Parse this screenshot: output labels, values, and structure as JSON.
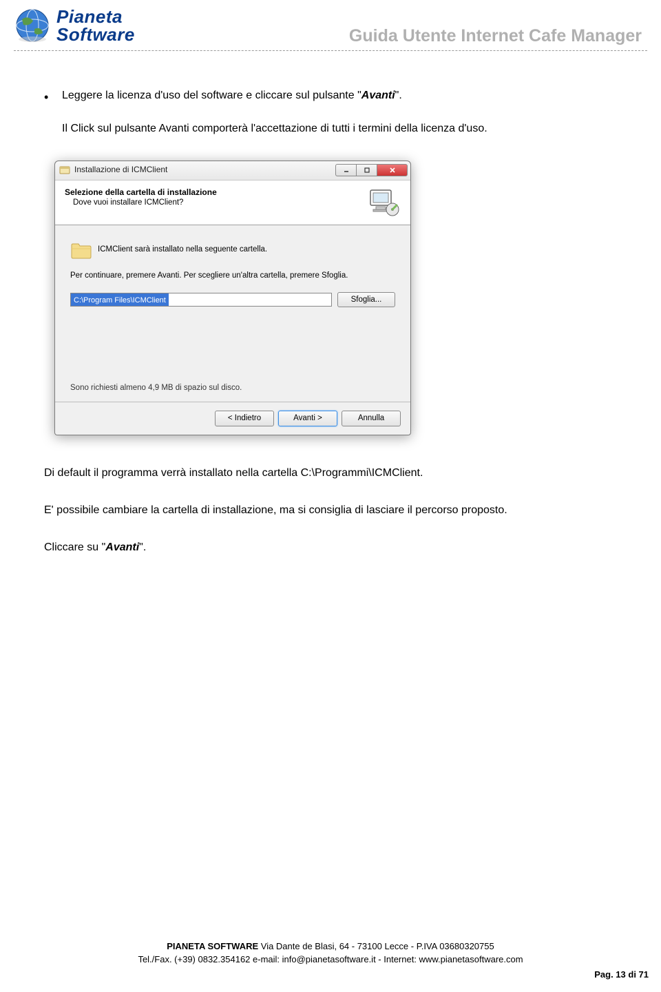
{
  "header": {
    "logo_line1": "Pianeta",
    "logo_line2": "Software",
    "doc_title": "Guida Utente Internet Cafe Manager"
  },
  "body": {
    "bullet1_a": "Leggere la licenza d'uso del software e cliccare sul pulsante \"",
    "bullet1_b": "Avanti",
    "bullet1_c": "\".",
    "para2": "Il Click sul pulsante Avanti comporterà l'accettazione di tutti i termini della licenza d'uso.",
    "para3": "Di default il programma verrà installato nella cartella C:\\Programmi\\ICMClient.",
    "para4": "E' possibile cambiare la cartella di installazione, ma si consiglia di lasciare il percorso proposto.",
    "para5_a": "Cliccare su \"",
    "para5_b": "Avanti",
    "para5_c": "\"."
  },
  "installer": {
    "title": "Installazione di ICMClient",
    "header_bold": "Selezione della cartella di installazione",
    "header_sub": "Dove vuoi installare ICMClient?",
    "folder_msg": "ICMClient sarà installato nella seguente cartella.",
    "instruction": "Per continuare, premere Avanti. Per scegliere un'altra cartella, premere Sfoglia.",
    "path_value": "C:\\Program Files\\ICMClient",
    "browse_btn": "Sfoglia...",
    "space_msg": "Sono richiesti almeno 4,9 MB di spazio sul disco.",
    "btn_back": "< Indietro",
    "btn_next": "Avanti >",
    "btn_cancel": "Annulla"
  },
  "footer": {
    "line1_a": "PIANETA SOFTWARE",
    "line1_b": " Via Dante de Blasi, 64 - 73100 Lecce -  P.IVA 03680320755",
    "line2": "Tel./Fax. (+39) 0832.354162 e-mail: info@pianetasoftware.it -  Internet: www.pianetasoftware.com",
    "page": "Pag. 13 di 71"
  }
}
